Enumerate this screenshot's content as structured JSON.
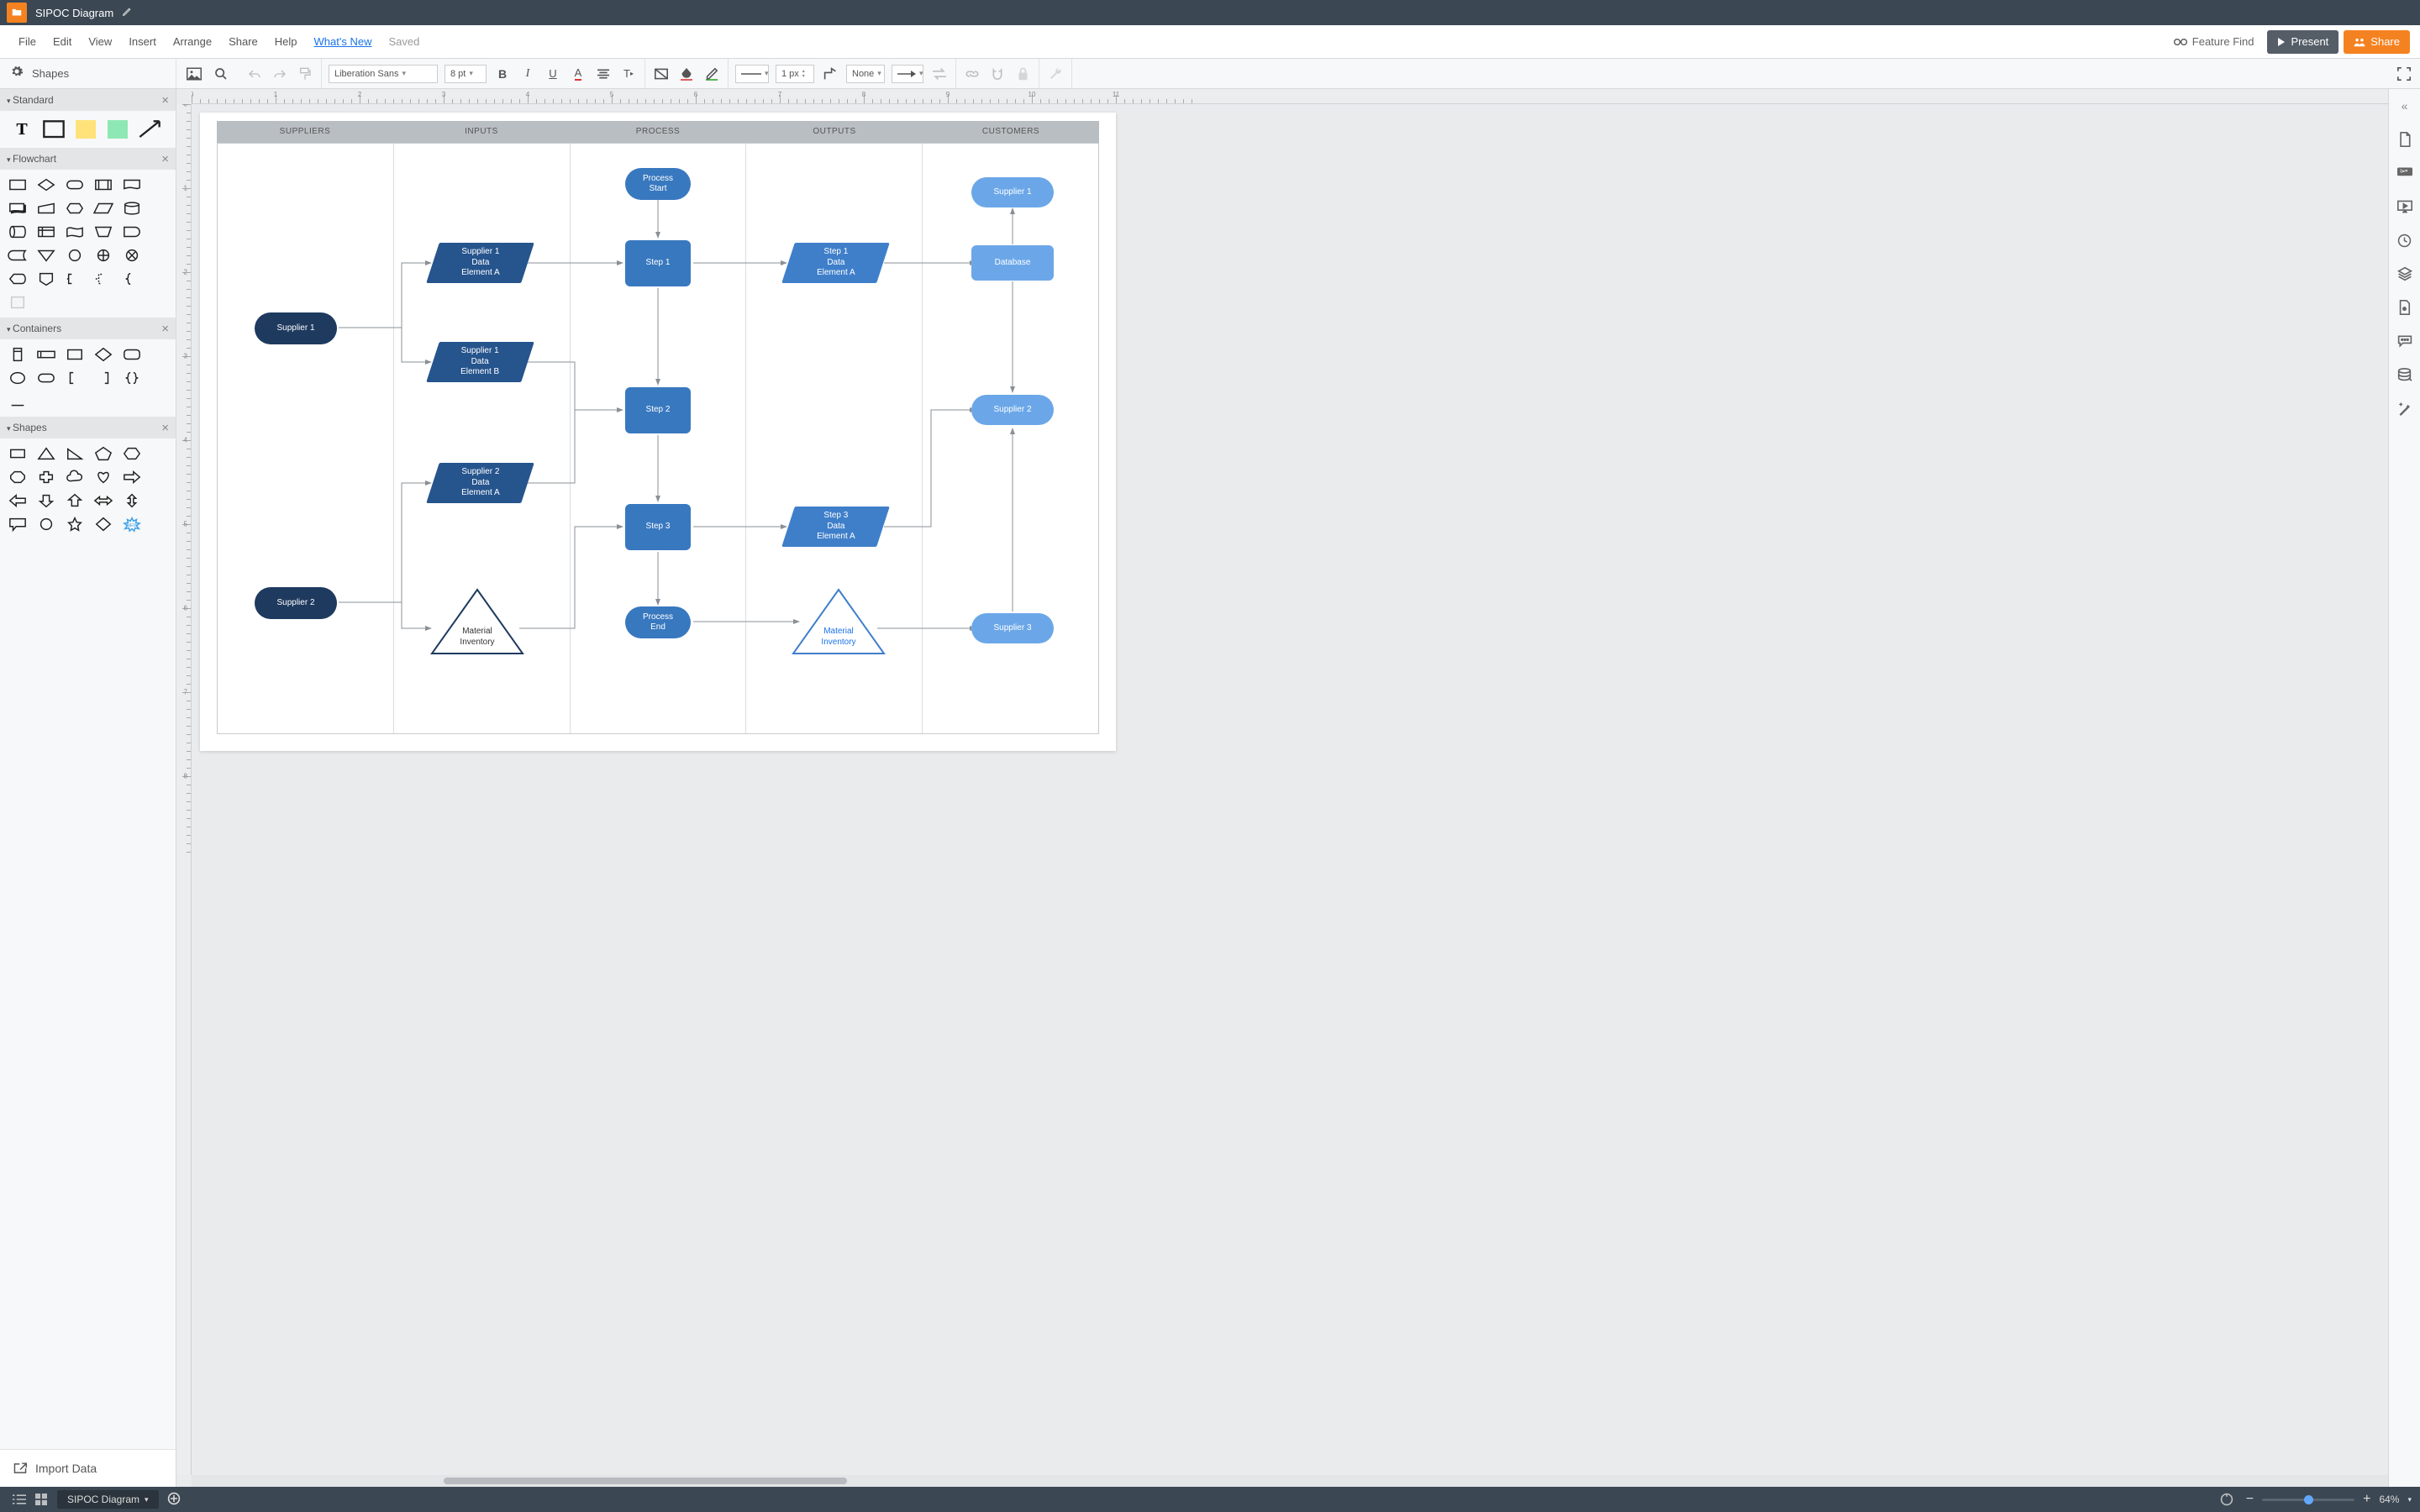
{
  "titlebar": {
    "doc_title": "SIPOC Diagram"
  },
  "menu": {
    "items": [
      "File",
      "Edit",
      "View",
      "Insert",
      "Arrange",
      "Share",
      "Help"
    ],
    "whats_new": "What's New",
    "saved": "Saved",
    "feature_find": "Feature Find",
    "present": "Present",
    "share": "Share"
  },
  "ribbon": {
    "shapes": "Shapes",
    "font_family": "Liberation Sans",
    "font_size": "8 pt",
    "line_width": "1 px",
    "line_end": "None"
  },
  "categories": {
    "standard": "Standard",
    "flowchart": "Flowchart",
    "containers": "Containers",
    "shapes": "Shapes"
  },
  "import_data": "Import Data",
  "bottombar": {
    "page_tab": "SIPOC Diagram",
    "zoom": "64%"
  },
  "sipoc": {
    "headers": [
      "SUPPLIERS",
      "INPUTS",
      "PROCESS",
      "OUTPUTS",
      "CUSTOMERS"
    ],
    "suppliers": {
      "s1": "Supplier 1",
      "s2": "Supplier 2"
    },
    "inputs": {
      "i1": "Supplier 1\nData\nElement A",
      "i2": "Supplier 1\nData\nElement B",
      "i3": "Supplier 2\nData\nElement A",
      "inv": "Material\nInventory"
    },
    "process": {
      "start": "Process\nStart",
      "s1": "Step 1",
      "s2": "Step 2",
      "s3": "Step 3",
      "end": "Process\nEnd"
    },
    "outputs": {
      "o1": "Step 1\nData\nElement A",
      "o3": "Step 3\nData\nElement A",
      "inv": "Material\nInventory"
    },
    "customers": {
      "c1": "Supplier 1",
      "db": "Database",
      "c2": "Supplier 2",
      "c3": "Supplier 3"
    }
  }
}
